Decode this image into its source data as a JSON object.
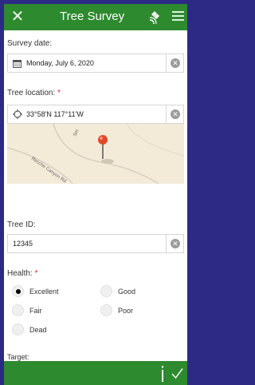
{
  "header": {
    "title": "Tree Survey",
    "icons": [
      "close-icon",
      "satellite-icon",
      "menu-icon"
    ]
  },
  "survey_date": {
    "label": "Survey date:",
    "value": "Monday, July 6, 2020"
  },
  "tree_location": {
    "label": "Tree location:",
    "required_mark": "*",
    "value": "33°58'N 117°11'W"
  },
  "map": {
    "road_labels": [
      "Sm",
      "Recche Canyon Rd"
    ]
  },
  "tree_id": {
    "label": "Tree ID:",
    "value": "12345"
  },
  "health": {
    "label": "Health:",
    "required_mark": "*",
    "options": [
      "Excellent",
      "Good",
      "Fair",
      "Poor",
      "Dead"
    ],
    "selected": "Excellent"
  },
  "target": {
    "label": "Target:"
  },
  "colors": {
    "header": "#2e8a2e",
    "background": "#2d2a86",
    "required": "#d7263d"
  }
}
